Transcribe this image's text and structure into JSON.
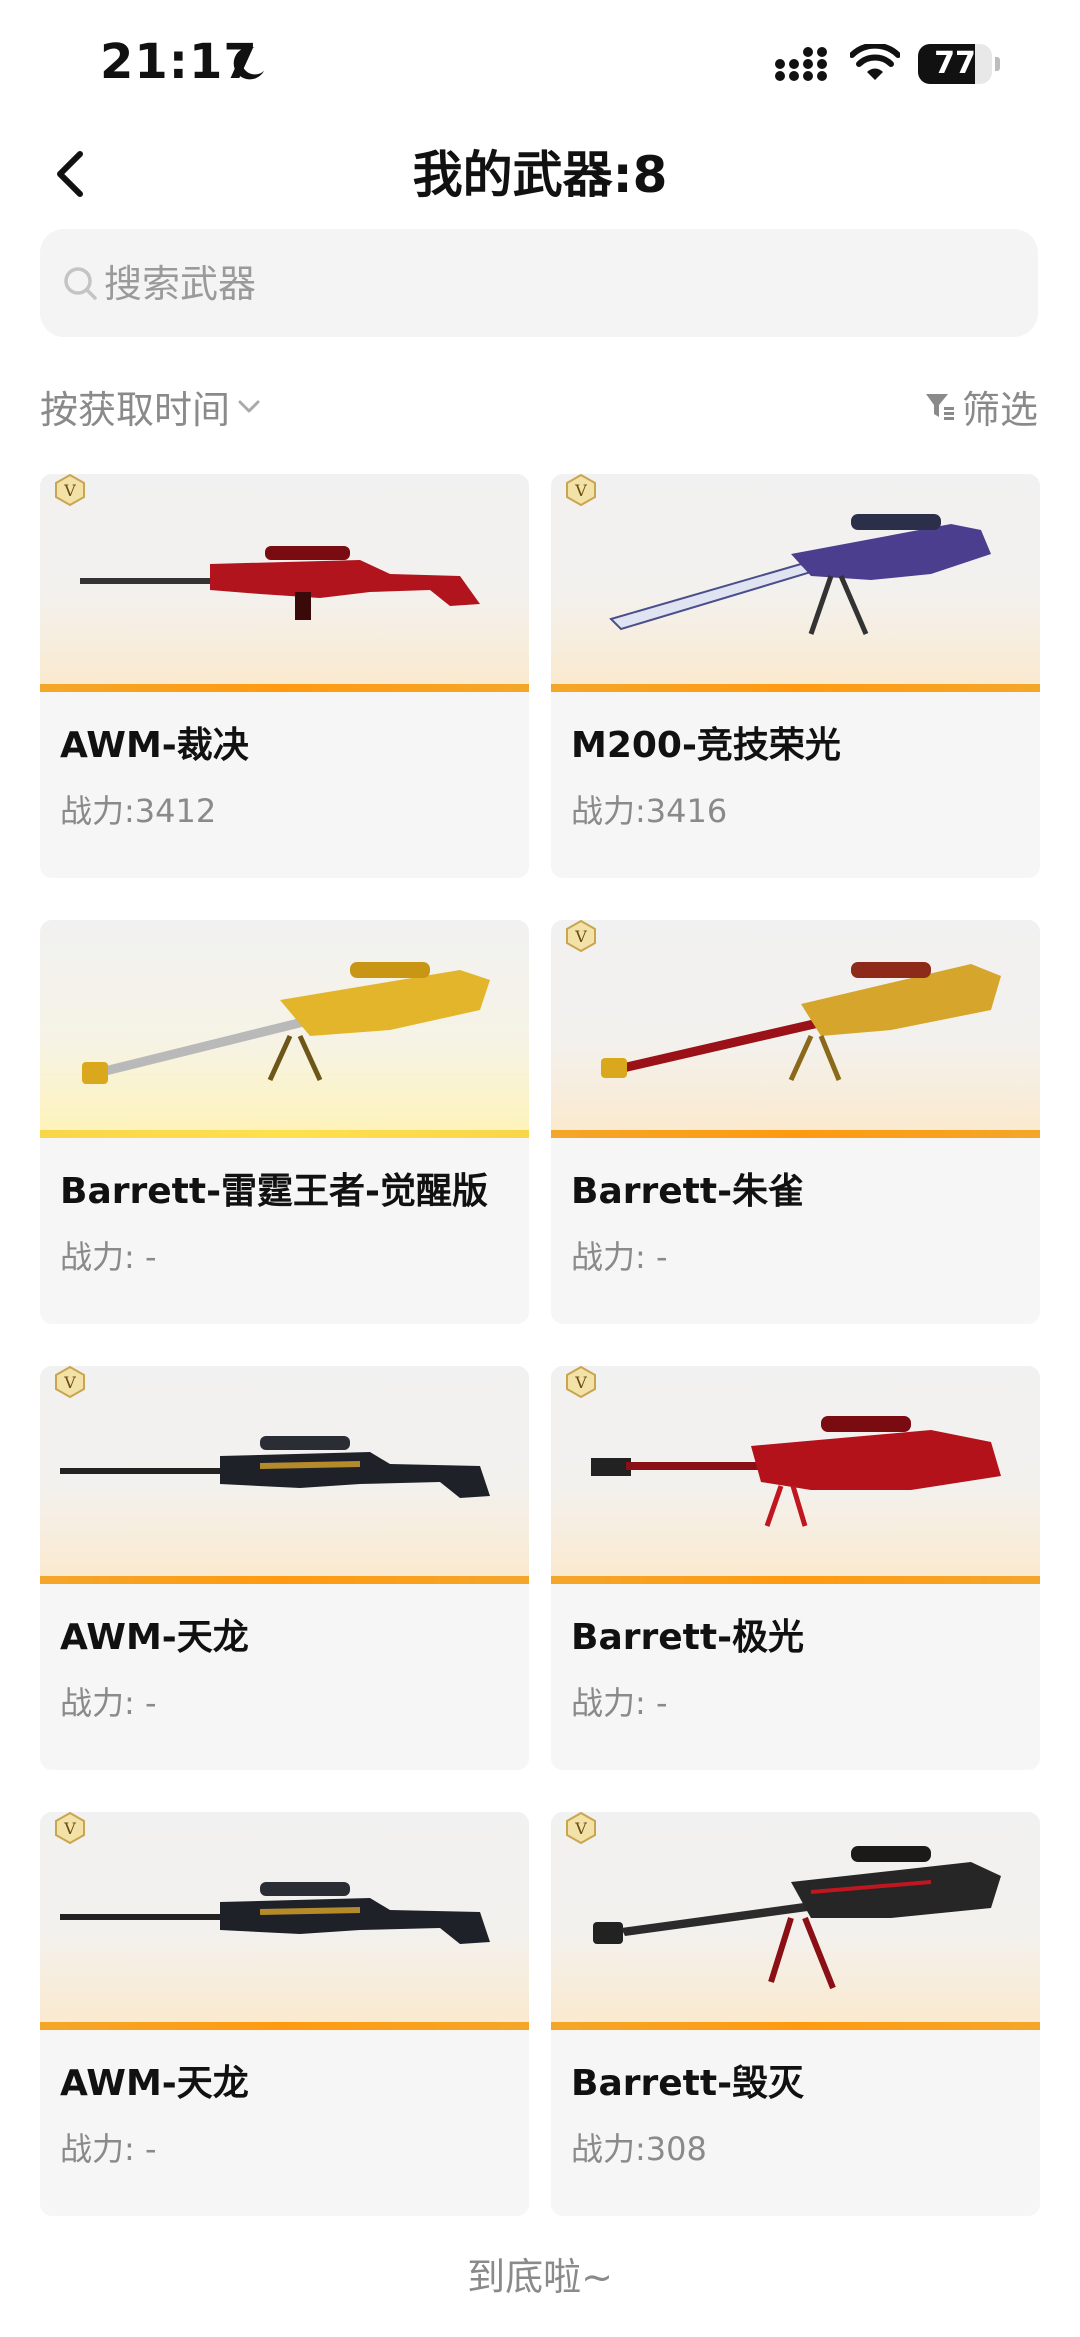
{
  "status_bar": {
    "time": "21:17",
    "battery": "77",
    "battery_level": 0.77
  },
  "header": {
    "title": "我的武器:8"
  },
  "search": {
    "placeholder": "搜索武器"
  },
  "toolbar": {
    "sort_label": "按获取时间",
    "filter_label": "筛选"
  },
  "weapons": [
    {
      "name": "AWM-裁决",
      "power": "战力:3412",
      "badge": true,
      "style": "orange"
    },
    {
      "name": "M200-竞技荣光",
      "power": "战力:3416",
      "badge": true,
      "style": "orange"
    },
    {
      "name": "Barrett-雷霆王者-觉醒版",
      "power": "战力: -",
      "badge": false,
      "style": "yellow"
    },
    {
      "name": "Barrett-朱雀",
      "power": "战力: -",
      "badge": true,
      "style": "orange"
    },
    {
      "name": "AWM-天龙",
      "power": "战力: -",
      "badge": true,
      "style": "orange"
    },
    {
      "name": "Barrett-极光",
      "power": "战力: -",
      "badge": true,
      "style": "orange"
    },
    {
      "name": "AWM-天龙",
      "power": "战力: -",
      "badge": true,
      "style": "orange"
    },
    {
      "name": "Barrett-毁灭",
      "power": "战力:308",
      "badge": true,
      "style": "orange"
    }
  ],
  "footer": {
    "text": "到底啦~"
  }
}
